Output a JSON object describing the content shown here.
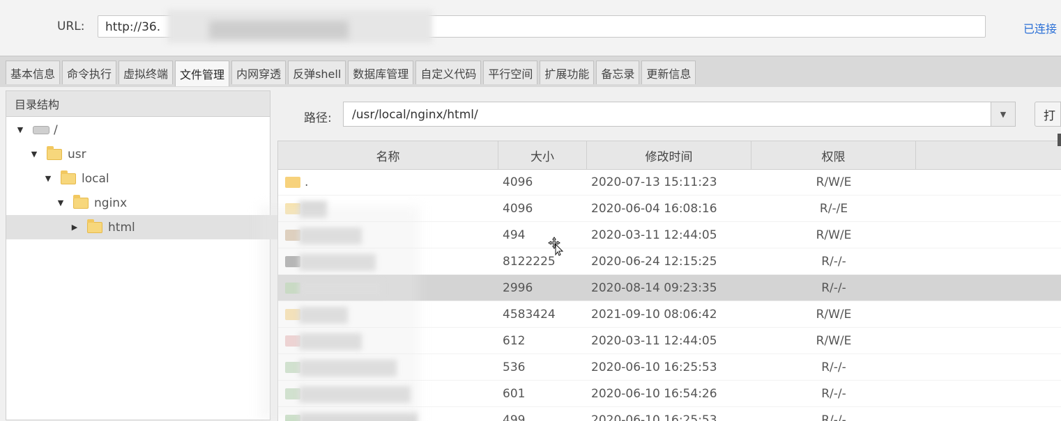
{
  "connection": {
    "url_label": "URL:",
    "url_value": "http://36.",
    "status": "已连接"
  },
  "tabs": [
    {
      "label": "基本信息",
      "active": false
    },
    {
      "label": "命令执行",
      "active": false
    },
    {
      "label": "虚拟终端",
      "active": false
    },
    {
      "label": "文件管理",
      "active": true
    },
    {
      "label": "内网穿透",
      "active": false
    },
    {
      "label": "反弹shell",
      "active": false
    },
    {
      "label": "数据库管理",
      "active": false
    },
    {
      "label": "自定义代码",
      "active": false
    },
    {
      "label": "平行空间",
      "active": false
    },
    {
      "label": "扩展功能",
      "active": false
    },
    {
      "label": "备忘录",
      "active": false
    },
    {
      "label": "更新信息",
      "active": false
    }
  ],
  "tree": {
    "header": "目录结构",
    "nodes": [
      {
        "label": "/",
        "icon": "drive-icon"
      },
      {
        "label": "usr",
        "icon": "folder-icon"
      },
      {
        "label": "local",
        "icon": "folder-icon"
      },
      {
        "label": "nginx",
        "icon": "folder-icon"
      },
      {
        "label": "html",
        "icon": "folder-icon",
        "selected": true
      }
    ]
  },
  "path": {
    "label": "路径:",
    "value": "/usr/local/nginx/html/",
    "open_button": "打"
  },
  "files": {
    "columns": [
      "名称",
      "大小",
      "修改时间",
      "权限"
    ],
    "rows": [
      {
        "name": ".",
        "size": "4096",
        "modified": "2020-07-13 15:11:23",
        "perm": "R/W/E",
        "icon_color": "#f7d27c"
      },
      {
        "name": "",
        "size": "4096",
        "modified": "2020-06-04 16:08:16",
        "perm": "R/-/E",
        "icon_color": "#f8e2a8"
      },
      {
        "name": "",
        "size": "494",
        "modified": "2020-03-11 12:44:05",
        "perm": "R/W/E",
        "icon_color": "#d7c2a8"
      },
      {
        "name": "",
        "size": "8122225",
        "modified": "2020-06-24 12:15:25",
        "perm": "R/-/-",
        "icon_color": "#9a9a9a"
      },
      {
        "name": "",
        "size": "2996",
        "modified": "2020-08-14 09:23:35",
        "perm": "R/-/-",
        "icon_color": "#b7d1b0",
        "selected": true
      },
      {
        "name": "",
        "size": "4583424",
        "modified": "2021-09-10 08:06:42",
        "perm": "R/W/E",
        "icon_color": "#f7dca0"
      },
      {
        "name": "",
        "size": "612",
        "modified": "2020-03-11 12:44:05",
        "perm": "R/W/E",
        "icon_color": "#eec7c7"
      },
      {
        "name": "",
        "size": "536",
        "modified": "2020-06-10 16:25:53",
        "perm": "R/-/-",
        "icon_color": "#c4dcc0"
      },
      {
        "name": "",
        "size": "601",
        "modified": "2020-06-10 16:54:26",
        "perm": "R/-/-",
        "icon_color": "#c4dcc0"
      },
      {
        "name": "",
        "size": "499",
        "modified": "2020-06-10 16:25:53",
        "perm": "R/-/-",
        "icon_color": "#c4dcc0"
      }
    ]
  }
}
